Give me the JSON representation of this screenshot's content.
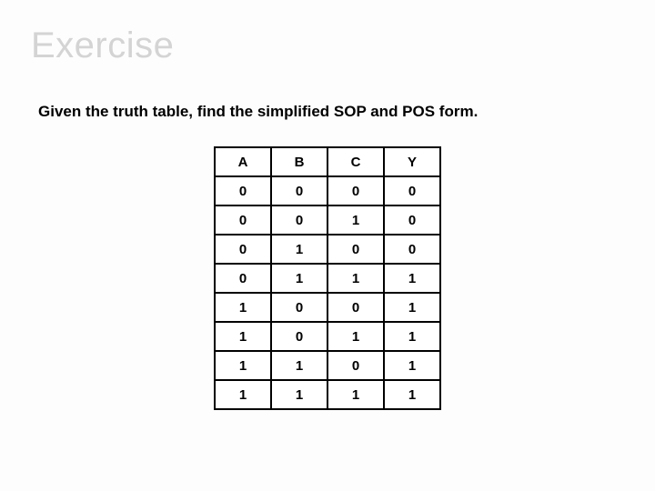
{
  "title": "Exercise",
  "prompt": "Given the truth table, find the simplified SOP and POS form.",
  "table": {
    "headers": [
      "A",
      "B",
      "C",
      "Y"
    ],
    "rows": [
      [
        "0",
        "0",
        "0",
        "0"
      ],
      [
        "0",
        "0",
        "1",
        "0"
      ],
      [
        "0",
        "1",
        "0",
        "0"
      ],
      [
        "0",
        "1",
        "1",
        "1"
      ],
      [
        "1",
        "0",
        "0",
        "1"
      ],
      [
        "1",
        "0",
        "1",
        "1"
      ],
      [
        "1",
        "1",
        "0",
        "1"
      ],
      [
        "1",
        "1",
        "1",
        "1"
      ]
    ]
  }
}
